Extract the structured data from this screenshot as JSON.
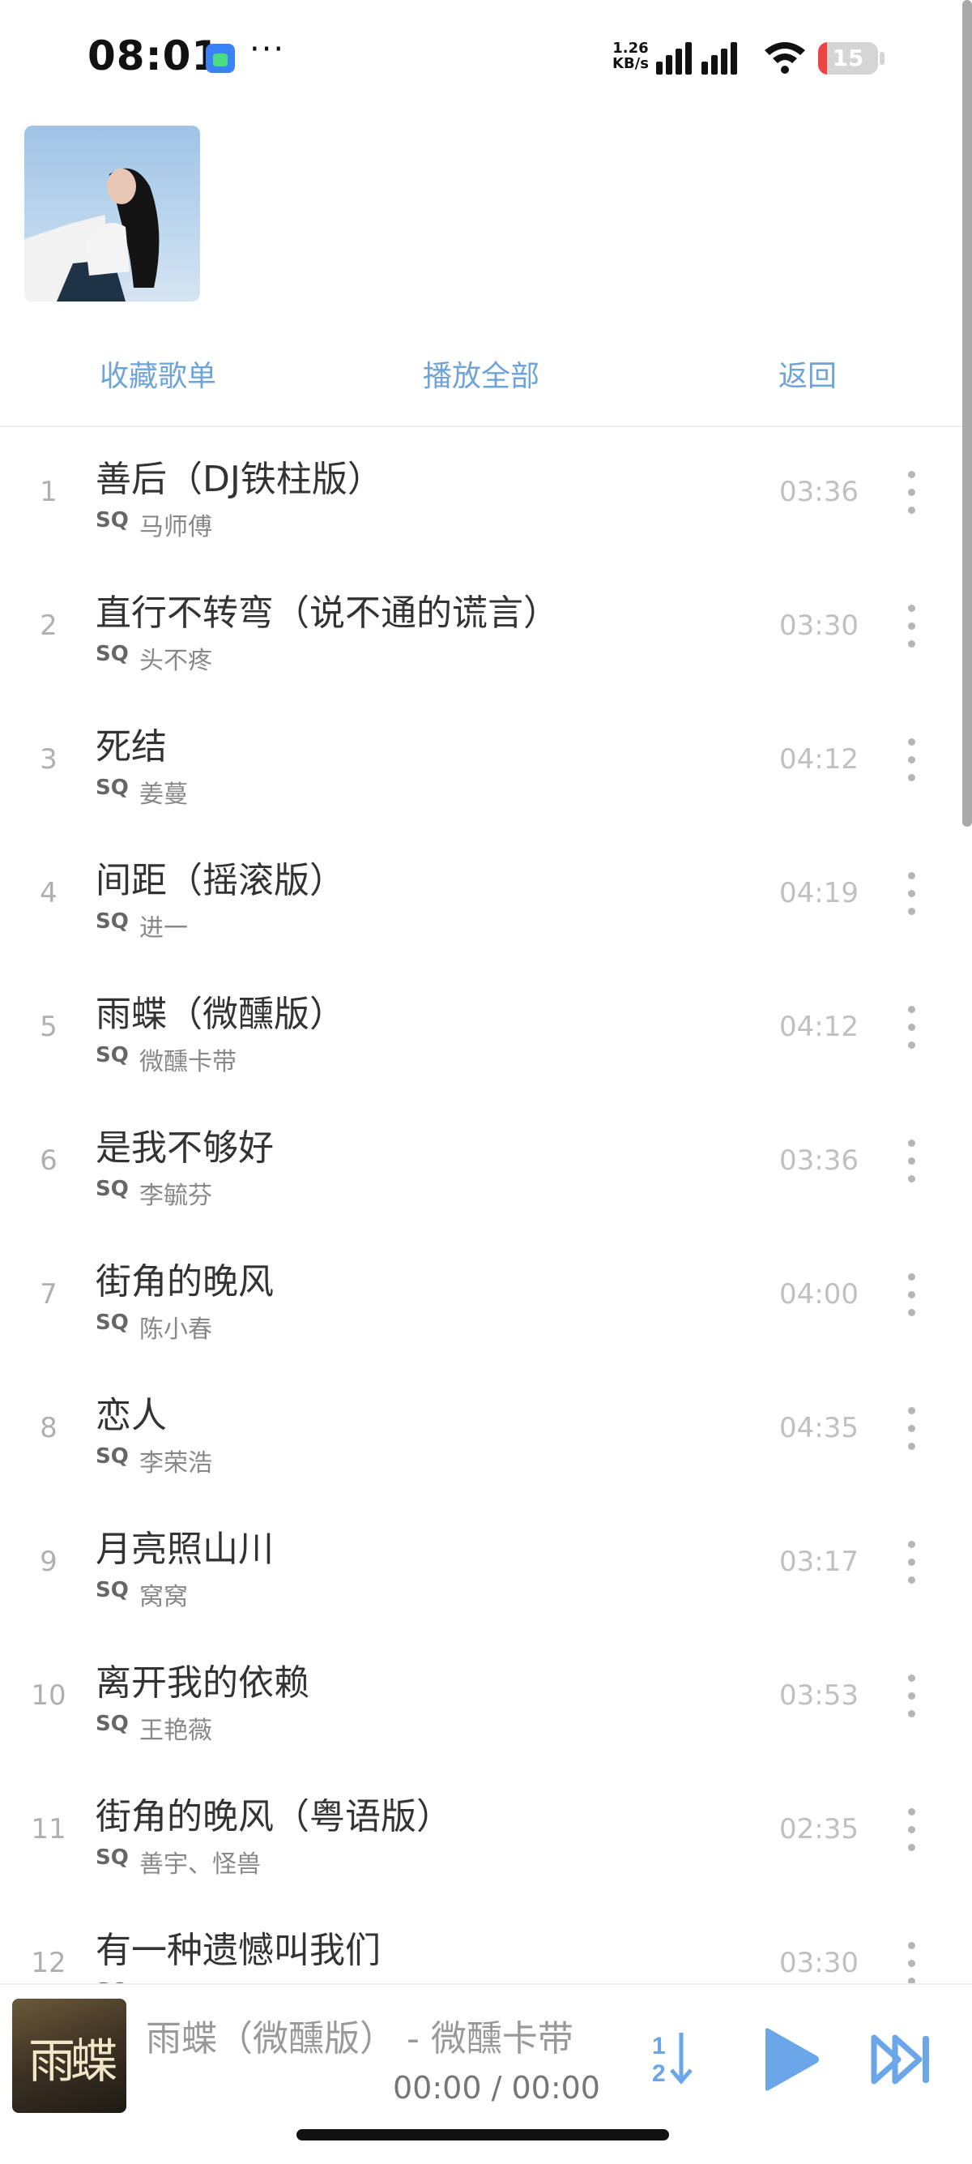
{
  "status": {
    "time": "08:01",
    "net_speed_value": "1.26",
    "net_speed_unit": "KB/s",
    "battery_level": "15",
    "battery_fraction": 0.15,
    "battery_color": "#ef4444"
  },
  "actions": {
    "favorite": "收藏歌单",
    "play_all": "播放全部",
    "back": "返回"
  },
  "songs": [
    {
      "index": "1",
      "title": "善后（DJ铁柱版）",
      "quality": "SQ",
      "artist": "马师傅",
      "duration": "03:36"
    },
    {
      "index": "2",
      "title": "直行不转弯（说不通的谎言）",
      "quality": "SQ",
      "artist": "头不疼",
      "duration": "03:30"
    },
    {
      "index": "3",
      "title": "死结",
      "quality": "SQ",
      "artist": "姜蔓",
      "duration": "04:12"
    },
    {
      "index": "4",
      "title": "间距（摇滚版）",
      "quality": "SQ",
      "artist": "进一",
      "duration": "04:19"
    },
    {
      "index": "5",
      "title": "雨蝶（微醺版）",
      "quality": "SQ",
      "artist": "微醺卡带",
      "duration": "04:12"
    },
    {
      "index": "6",
      "title": "是我不够好",
      "quality": "SQ",
      "artist": "李毓芬",
      "duration": "03:36"
    },
    {
      "index": "7",
      "title": "街角的晚风",
      "quality": "SQ",
      "artist": "陈小春",
      "duration": "04:00"
    },
    {
      "index": "8",
      "title": "恋人",
      "quality": "SQ",
      "artist": "李荣浩",
      "duration": "04:35"
    },
    {
      "index": "9",
      "title": "月亮照山川",
      "quality": "SQ",
      "artist": "窝窝",
      "duration": "03:17"
    },
    {
      "index": "10",
      "title": "离开我的依赖",
      "quality": "SQ",
      "artist": "王艳薇",
      "duration": "03:53"
    },
    {
      "index": "11",
      "title": "街角的晚风（粤语版）",
      "quality": "SQ",
      "artist": "善宇、怪兽",
      "duration": "02:35"
    },
    {
      "index": "12",
      "title": "有一种遗憾叫我们",
      "quality": "SQ",
      "artist": "",
      "duration": "03:30"
    }
  ],
  "player": {
    "now_playing": "雨蝶（微醺版） - 微醺卡带",
    "time": "00:00 / 00:00",
    "cover_text": "雨蝶",
    "order_icon": "sequential-order-icon",
    "play_icon": "play-icon",
    "next_icon": "skip-next-icon",
    "accent_color": "#6aa6e8"
  }
}
